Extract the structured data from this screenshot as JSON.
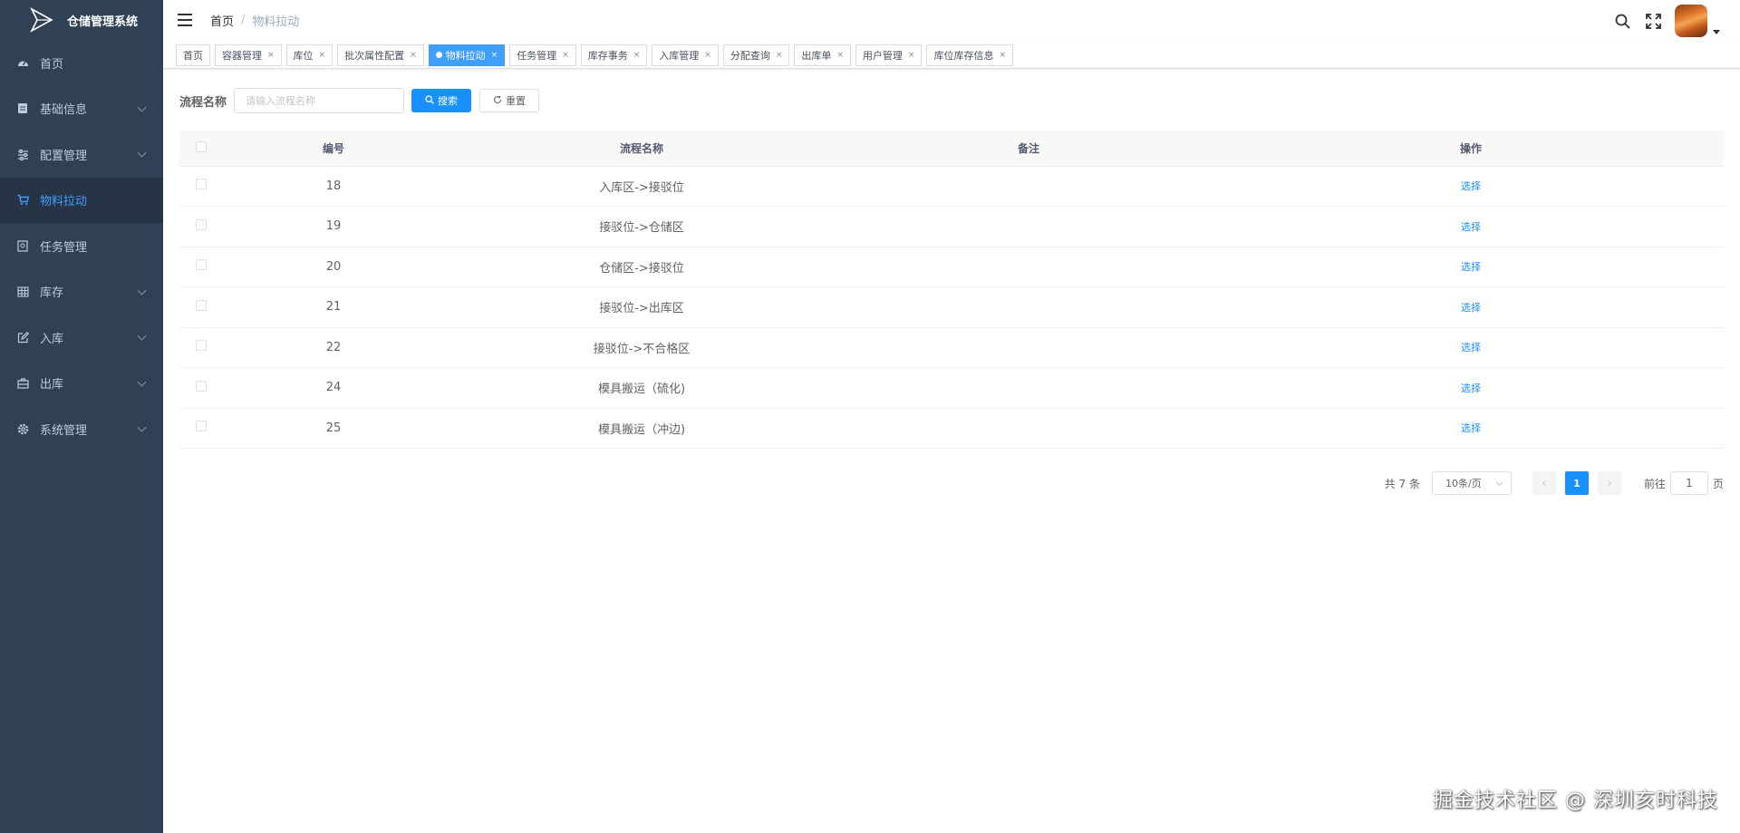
{
  "app": {
    "title": "仓储管理系统"
  },
  "sidebar": {
    "items": [
      {
        "label": "首页",
        "icon": "dashboard-icon",
        "expandable": false,
        "active": false
      },
      {
        "label": "基础信息",
        "icon": "document-icon",
        "expandable": true,
        "active": false
      },
      {
        "label": "配置管理",
        "icon": "sliders-icon",
        "expandable": true,
        "active": false
      },
      {
        "label": "物料拉动",
        "icon": "cart-icon",
        "expandable": false,
        "active": true
      },
      {
        "label": "任务管理",
        "icon": "task-icon",
        "expandable": false,
        "active": false
      },
      {
        "label": "库存",
        "icon": "grid-icon",
        "expandable": true,
        "active": false
      },
      {
        "label": "入库",
        "icon": "edit-icon",
        "expandable": true,
        "active": false
      },
      {
        "label": "出库",
        "icon": "box-icon",
        "expandable": true,
        "active": false
      },
      {
        "label": "系统管理",
        "icon": "gear-icon",
        "expandable": true,
        "active": false
      }
    ]
  },
  "breadcrumb": {
    "home": "首页",
    "separator": "/",
    "current": "物料拉动"
  },
  "tags": [
    {
      "label": "首页",
      "closable": false,
      "active": false
    },
    {
      "label": "容器管理",
      "closable": true,
      "active": false
    },
    {
      "label": "库位",
      "closable": true,
      "active": false
    },
    {
      "label": "批次属性配置",
      "closable": true,
      "active": false
    },
    {
      "label": "物料拉动",
      "closable": true,
      "active": true
    },
    {
      "label": "任务管理",
      "closable": true,
      "active": false
    },
    {
      "label": "库存事务",
      "closable": true,
      "active": false
    },
    {
      "label": "入库管理",
      "closable": true,
      "active": false
    },
    {
      "label": "分配查询",
      "closable": true,
      "active": false
    },
    {
      "label": "出库单",
      "closable": true,
      "active": false
    },
    {
      "label": "用户管理",
      "closable": true,
      "active": false
    },
    {
      "label": "库位库存信息",
      "closable": true,
      "active": false
    }
  ],
  "search": {
    "label": "流程名称",
    "placeholder": "请输入流程名称",
    "value": "",
    "search_button": "搜索",
    "reset_button": "重置"
  },
  "table": {
    "columns": [
      "编号",
      "流程名称",
      "备注",
      "操作"
    ],
    "rows": [
      {
        "id": "18",
        "name": "入库区->接驳位",
        "remark": "",
        "action": "选择"
      },
      {
        "id": "19",
        "name": "接驳位->仓储区",
        "remark": "",
        "action": "选择"
      },
      {
        "id": "20",
        "name": "仓储区->接驳位",
        "remark": "",
        "action": "选择"
      },
      {
        "id": "21",
        "name": "接驳位->出库区",
        "remark": "",
        "action": "选择"
      },
      {
        "id": "22",
        "name": "接驳位->不合格区",
        "remark": "",
        "action": "选择"
      },
      {
        "id": "24",
        "name": "模具搬运（硫化)",
        "remark": "",
        "action": "选择"
      },
      {
        "id": "25",
        "name": "模具搬运（冲边)",
        "remark": "",
        "action": "选择"
      }
    ]
  },
  "pagination": {
    "total_text": "共 7 条",
    "page_size": "10条/页",
    "current_page": "1",
    "goto_prefix": "前往",
    "goto_value": "1",
    "goto_suffix": "页"
  },
  "watermark": "掘金技术社区 @ 深圳亥时科技",
  "colors": {
    "sidebar_bg": "#304156",
    "sidebar_active_bg": "#263445",
    "accent": "#1890ff"
  }
}
